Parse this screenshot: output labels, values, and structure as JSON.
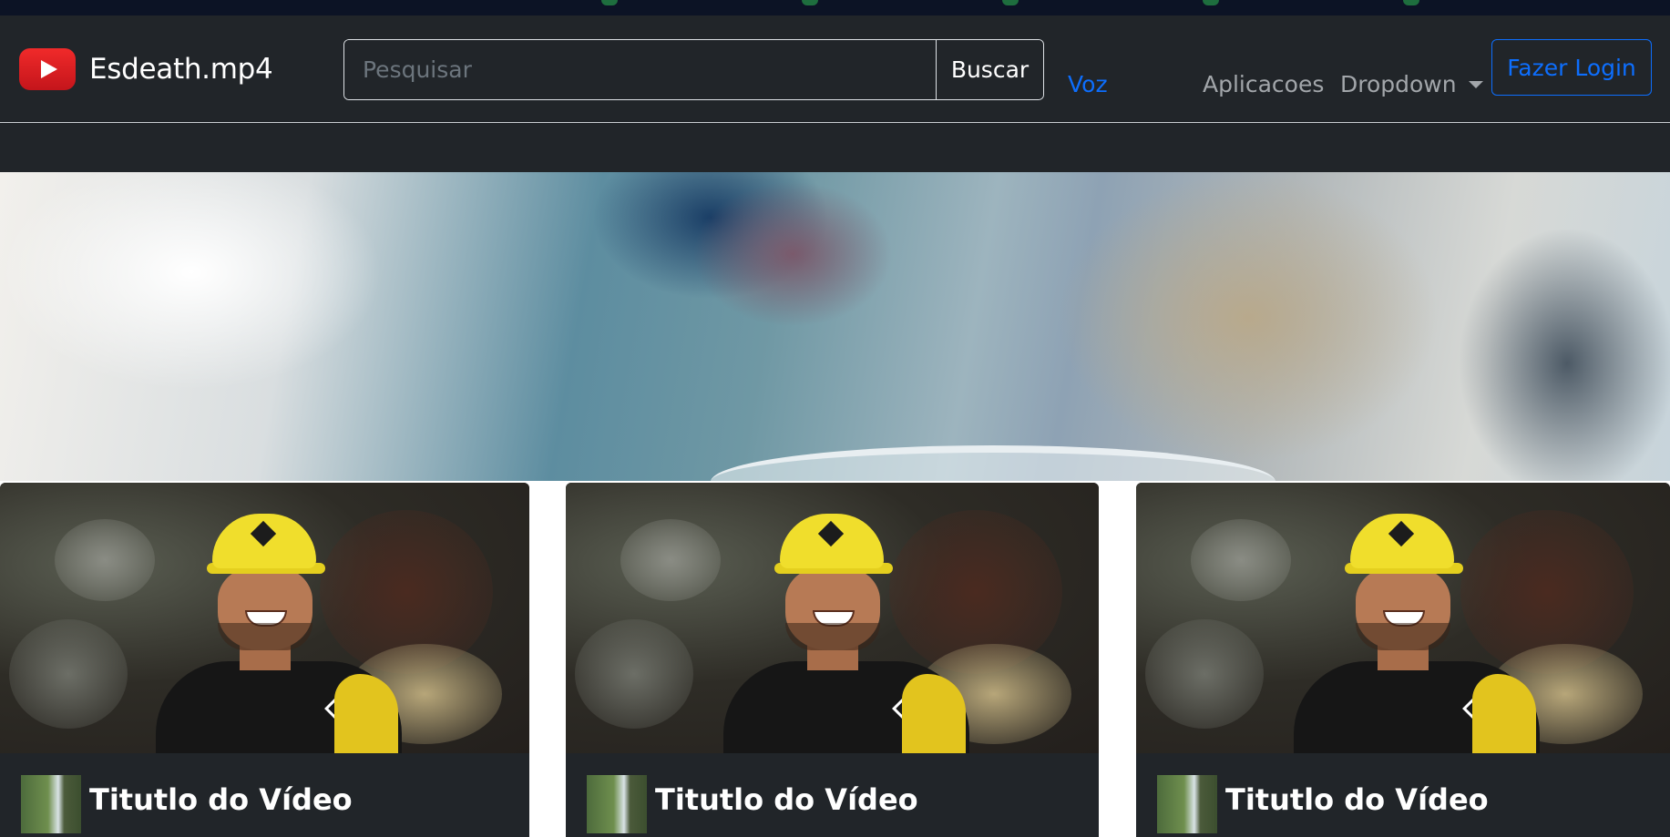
{
  "brand": {
    "name": "Esdeath.mp4",
    "logo_icon": "youtube-play-icon"
  },
  "search": {
    "placeholder": "Pesquisar",
    "value": "",
    "button_label": "Buscar"
  },
  "nav": {
    "voz": "Voz",
    "aplicacoes": "Aplicacoes",
    "dropdown": "Dropdown"
  },
  "login": {
    "label": "Fazer Login"
  },
  "colors": {
    "navbar_bg": "#212529",
    "accent_blue": "#0d6efd",
    "muted_link": "#a2a6aa",
    "brand_red": "#e62117"
  },
  "cards": [
    {
      "title": "Titutlo do Vídeo"
    },
    {
      "title": "Titutlo do Vídeo"
    },
    {
      "title": "Titutlo do Vídeo"
    }
  ]
}
